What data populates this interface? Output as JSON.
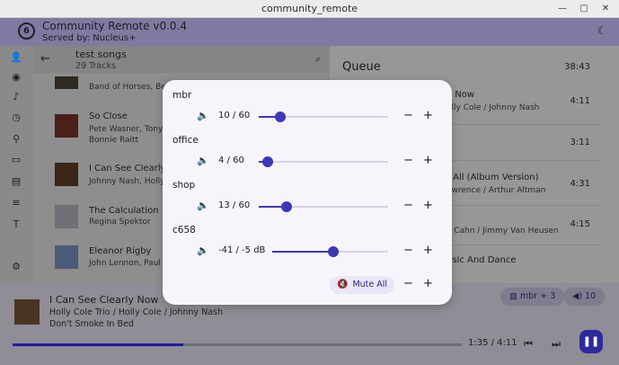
{
  "window": {
    "title": "community_remote"
  },
  "header": {
    "app_title": "Community Remote v0.0.4",
    "served_by": "Served by: Nucleus+",
    "logo_letter": "6"
  },
  "sidebar": {
    "items": [
      {
        "icon": "person-add-icon"
      },
      {
        "icon": "disc-icon"
      },
      {
        "icon": "music-note-icon"
      },
      {
        "icon": "album-icon"
      },
      {
        "icon": "person-icon"
      },
      {
        "icon": "tag-icon"
      },
      {
        "icon": "radio-icon"
      },
      {
        "icon": "playlist-icon"
      },
      {
        "icon": "text-icon"
      },
      {
        "icon": "settings-icon"
      }
    ]
  },
  "tracks": {
    "title": "test songs",
    "count": "29 Tracks",
    "items": [
      {
        "title": "",
        "subtitle": "Band of Horses, Be"
      },
      {
        "title": "So Close",
        "subtitle": "Pete Wasner, Tony A",
        "subtitle2": "Bonnie Raitt"
      },
      {
        "title": "I Can See Clearly",
        "subtitle": "Johnny Nash, Holly"
      },
      {
        "title": "The Calculation",
        "subtitle": "Regina Spektor"
      },
      {
        "title": "Eleanor Rigby",
        "subtitle": "John Lennon, Paul M"
      }
    ]
  },
  "queue": {
    "title": "Queue",
    "total": "38:43",
    "items": [
      {
        "title": "o Now",
        "subtitle": "olly Cole / Johnny Nash",
        "duration": "4:11"
      },
      {
        "title": "",
        "subtitle": "",
        "duration": "3:11"
      },
      {
        "title": "t All (Album Version)",
        "subtitle": "awrence / Arthur Altman",
        "duration": "4:31"
      },
      {
        "title": "",
        "subtitle": "y Cahn / Jimmy Van Heusen",
        "duration": "4:15"
      },
      {
        "title": "usic And Dance",
        "subtitle": "",
        "duration": ""
      }
    ]
  },
  "now_playing": {
    "title": "I Can See Clearly Now",
    "artist": "Holly Cole Trio / Holly Cole / Johnny Nash",
    "album": "Don't Smoke In Bed",
    "time": "1:35 / 4:11",
    "progress": 0.38,
    "zones_pill": "mbr + 3",
    "volume_pill": "10"
  },
  "volume_modal": {
    "zones": [
      {
        "name": "mbr",
        "value": "10 / 60",
        "level": 0.167
      },
      {
        "name": "office",
        "value": "4 / 60",
        "level": 0.067
      },
      {
        "name": "shop",
        "value": "13 / 60",
        "level": 0.217
      },
      {
        "name": "c658",
        "value": "-41 / -5 dB",
        "level": 0.53
      }
    ],
    "mute_all": "Mute All",
    "minus": "−",
    "plus": "+"
  },
  "colors": {
    "accent": "#3b37b9",
    "header": "#807aa0",
    "modal_bg": "#f7f5fb"
  }
}
